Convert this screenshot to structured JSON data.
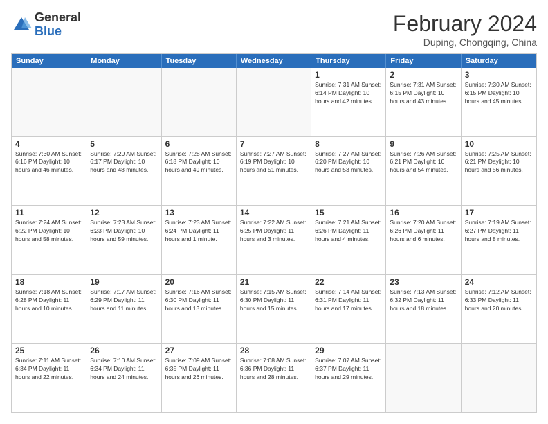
{
  "header": {
    "logo_general": "General",
    "logo_blue": "Blue",
    "title": "February 2024",
    "location": "Duping, Chongqing, China"
  },
  "days_of_week": [
    "Sunday",
    "Monday",
    "Tuesday",
    "Wednesday",
    "Thursday",
    "Friday",
    "Saturday"
  ],
  "weeks": [
    [
      {
        "day": "",
        "info": ""
      },
      {
        "day": "",
        "info": ""
      },
      {
        "day": "",
        "info": ""
      },
      {
        "day": "",
        "info": ""
      },
      {
        "day": "1",
        "info": "Sunrise: 7:31 AM\nSunset: 6:14 PM\nDaylight: 10 hours\nand 42 minutes."
      },
      {
        "day": "2",
        "info": "Sunrise: 7:31 AM\nSunset: 6:15 PM\nDaylight: 10 hours\nand 43 minutes."
      },
      {
        "day": "3",
        "info": "Sunrise: 7:30 AM\nSunset: 6:15 PM\nDaylight: 10 hours\nand 45 minutes."
      }
    ],
    [
      {
        "day": "4",
        "info": "Sunrise: 7:30 AM\nSunset: 6:16 PM\nDaylight: 10 hours\nand 46 minutes."
      },
      {
        "day": "5",
        "info": "Sunrise: 7:29 AM\nSunset: 6:17 PM\nDaylight: 10 hours\nand 48 minutes."
      },
      {
        "day": "6",
        "info": "Sunrise: 7:28 AM\nSunset: 6:18 PM\nDaylight: 10 hours\nand 49 minutes."
      },
      {
        "day": "7",
        "info": "Sunrise: 7:27 AM\nSunset: 6:19 PM\nDaylight: 10 hours\nand 51 minutes."
      },
      {
        "day": "8",
        "info": "Sunrise: 7:27 AM\nSunset: 6:20 PM\nDaylight: 10 hours\nand 53 minutes."
      },
      {
        "day": "9",
        "info": "Sunrise: 7:26 AM\nSunset: 6:21 PM\nDaylight: 10 hours\nand 54 minutes."
      },
      {
        "day": "10",
        "info": "Sunrise: 7:25 AM\nSunset: 6:21 PM\nDaylight: 10 hours\nand 56 minutes."
      }
    ],
    [
      {
        "day": "11",
        "info": "Sunrise: 7:24 AM\nSunset: 6:22 PM\nDaylight: 10 hours\nand 58 minutes."
      },
      {
        "day": "12",
        "info": "Sunrise: 7:23 AM\nSunset: 6:23 PM\nDaylight: 10 hours\nand 59 minutes."
      },
      {
        "day": "13",
        "info": "Sunrise: 7:23 AM\nSunset: 6:24 PM\nDaylight: 11 hours\nand 1 minute."
      },
      {
        "day": "14",
        "info": "Sunrise: 7:22 AM\nSunset: 6:25 PM\nDaylight: 11 hours\nand 3 minutes."
      },
      {
        "day": "15",
        "info": "Sunrise: 7:21 AM\nSunset: 6:26 PM\nDaylight: 11 hours\nand 4 minutes."
      },
      {
        "day": "16",
        "info": "Sunrise: 7:20 AM\nSunset: 6:26 PM\nDaylight: 11 hours\nand 6 minutes."
      },
      {
        "day": "17",
        "info": "Sunrise: 7:19 AM\nSunset: 6:27 PM\nDaylight: 11 hours\nand 8 minutes."
      }
    ],
    [
      {
        "day": "18",
        "info": "Sunrise: 7:18 AM\nSunset: 6:28 PM\nDaylight: 11 hours\nand 10 minutes."
      },
      {
        "day": "19",
        "info": "Sunrise: 7:17 AM\nSunset: 6:29 PM\nDaylight: 11 hours\nand 11 minutes."
      },
      {
        "day": "20",
        "info": "Sunrise: 7:16 AM\nSunset: 6:30 PM\nDaylight: 11 hours\nand 13 minutes."
      },
      {
        "day": "21",
        "info": "Sunrise: 7:15 AM\nSunset: 6:30 PM\nDaylight: 11 hours\nand 15 minutes."
      },
      {
        "day": "22",
        "info": "Sunrise: 7:14 AM\nSunset: 6:31 PM\nDaylight: 11 hours\nand 17 minutes."
      },
      {
        "day": "23",
        "info": "Sunrise: 7:13 AM\nSunset: 6:32 PM\nDaylight: 11 hours\nand 18 minutes."
      },
      {
        "day": "24",
        "info": "Sunrise: 7:12 AM\nSunset: 6:33 PM\nDaylight: 11 hours\nand 20 minutes."
      }
    ],
    [
      {
        "day": "25",
        "info": "Sunrise: 7:11 AM\nSunset: 6:34 PM\nDaylight: 11 hours\nand 22 minutes."
      },
      {
        "day": "26",
        "info": "Sunrise: 7:10 AM\nSunset: 6:34 PM\nDaylight: 11 hours\nand 24 minutes."
      },
      {
        "day": "27",
        "info": "Sunrise: 7:09 AM\nSunset: 6:35 PM\nDaylight: 11 hours\nand 26 minutes."
      },
      {
        "day": "28",
        "info": "Sunrise: 7:08 AM\nSunset: 6:36 PM\nDaylight: 11 hours\nand 28 minutes."
      },
      {
        "day": "29",
        "info": "Sunrise: 7:07 AM\nSunset: 6:37 PM\nDaylight: 11 hours\nand 29 minutes."
      },
      {
        "day": "",
        "info": ""
      },
      {
        "day": "",
        "info": ""
      }
    ]
  ]
}
